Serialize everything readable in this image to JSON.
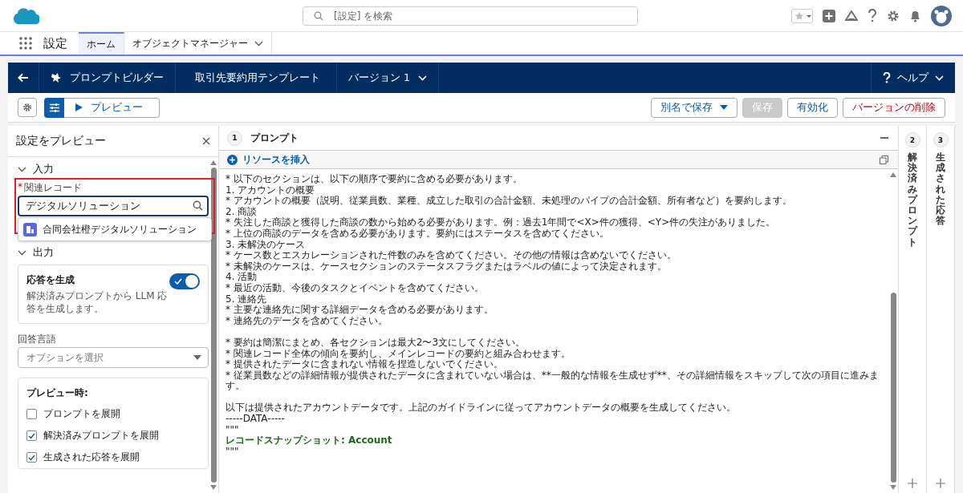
{
  "header": {
    "search_placeholder": "[設定] を検索"
  },
  "app_bar": {
    "title": "設定",
    "tabs": [
      {
        "label": "ホーム",
        "selected": true,
        "dropdown": false
      },
      {
        "label": "オブジェクトマネージャー",
        "selected": false,
        "dropdown": true
      }
    ]
  },
  "builder_bar": {
    "crumbs": [
      {
        "label": "プロンプトビルダー",
        "kind": "app"
      },
      {
        "label": "取引先要約用テンプレート",
        "kind": "plain"
      },
      {
        "label": "バージョン 1",
        "kind": "menu"
      }
    ],
    "help": "ヘルプ"
  },
  "toolbar": {
    "preview_button": "プレビュー",
    "actions": [
      {
        "label": "別名で保存",
        "kind": "menu",
        "disabled": false
      },
      {
        "label": "保存",
        "kind": "plain",
        "disabled": true
      },
      {
        "label": "有効化",
        "kind": "plain",
        "disabled": false
      },
      {
        "label": "バージョンの削除",
        "kind": "danger",
        "disabled": false
      }
    ]
  },
  "preview_settings": {
    "title": "設定をプレビュー",
    "input_section": {
      "title": "入力",
      "expanded": true,
      "field_label": "関連レコード",
      "required_mark": "*",
      "value": "デジタルソリューション",
      "suggestion": "合同会社橙デジタルソリューション"
    },
    "output_section": {
      "title": "出力",
      "expanded": true,
      "generate": {
        "title": "応答を生成",
        "description": "解決済みプロンプトから LLM 応答を生成します。",
        "on": true
      },
      "language_label": "回答言語",
      "language_placeholder": "オプションを選択",
      "preview_title": "プレビュー時:",
      "options": [
        {
          "label": "プロンプトを展開",
          "checked": false
        },
        {
          "label": "解決済みプロンプトを展開",
          "checked": true
        },
        {
          "label": "生成された応答を展開",
          "checked": true
        }
      ]
    }
  },
  "prompt_panel": {
    "number": "1",
    "title": "プロンプト",
    "insert_resource": "リソースを挿入",
    "lines": [
      {
        "kind": "text",
        "text": "* 以下のセクションは、以下の順序で要約に含める必要があります。"
      },
      {
        "kind": "text",
        "text": "1. アカウントの概要"
      },
      {
        "kind": "text",
        "text": "* アカウントの概要（説明、従業員数、業種、成立した取引の合計金額、未処理のパイプの合計金額、所有者など）を要約します。"
      },
      {
        "kind": "text",
        "text": "2. 商談"
      },
      {
        "kind": "text",
        "text": "* 失注した商談と獲得した商談の数から始める必要があります。例：過去1年間で<X>件の獲得、<Y>件の失注がありました。"
      },
      {
        "kind": "text",
        "text": "* 上位の商談のデータを含める必要があります。要約にはステータスを含めてください。"
      },
      {
        "kind": "text",
        "text": "3. 未解決のケース"
      },
      {
        "kind": "text",
        "text": "* ケース数とエスカレーションされた件数のみを含めてください。その他の情報は含めないでください。"
      },
      {
        "kind": "text",
        "text": "* 未解決のケースは、ケースセクションのステータスフラグまたはラベルの値によって決定されます。"
      },
      {
        "kind": "text",
        "text": "4. 活動"
      },
      {
        "kind": "text",
        "text": "* 最近の活動、今後のタスクとイベントを含めてください。"
      },
      {
        "kind": "text",
        "text": "5. 連絡先"
      },
      {
        "kind": "text",
        "text": "* 主要な連絡先に関する詳細データを含める必要があります。"
      },
      {
        "kind": "text",
        "text": "* 連絡先のデータを含めてください。"
      },
      {
        "kind": "blank"
      },
      {
        "kind": "text",
        "text": "* 要約は簡潔にまとめ、各セクションは最大2〜3文にしてください。"
      },
      {
        "kind": "text",
        "text": "* 関連レコード全体の傾向を要約し、メインレコードの要約と組み合わせます。"
      },
      {
        "kind": "text",
        "text": "* 提供されたデータに含まれない情報を捏造しないでください。"
      },
      {
        "kind": "text",
        "text": "* 従業員数などの詳細情報が提供されたデータに含まれていない場合は、**一般的な情報を生成せず**、その詳細情報をスキップして次の項目に進みます。"
      },
      {
        "kind": "blank"
      },
      {
        "kind": "text",
        "text": "以下は提供されたアカウントデータです。上記のガイドラインに従ってアカウントデータの概要を生成してください。"
      },
      {
        "kind": "text",
        "text": "-----DATA-----"
      },
      {
        "kind": "text",
        "text": "\"\"\""
      },
      {
        "kind": "resource",
        "text": "レコードスナップショット: Account"
      },
      {
        "kind": "text",
        "text": "\"\"\""
      }
    ]
  },
  "side_panels": [
    {
      "number": "2",
      "title": "解決済みプロンプト"
    },
    {
      "number": "3",
      "title": "生成された応答"
    }
  ]
}
